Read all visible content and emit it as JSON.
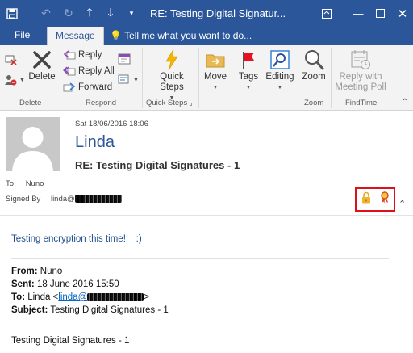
{
  "titlebar": {
    "title": "RE: Testing Digital Signatur...",
    "save_icon": "save-icon",
    "undo_icon": "undo-icon",
    "redo_icon": "redo-icon",
    "up_icon": "arrow-up-icon",
    "down_icon": "arrow-down-icon",
    "qat_icon": "customize-quick-access-icon"
  },
  "tabs": {
    "file": "File",
    "message": "Message",
    "tell_me": "Tell me what you want to do..."
  },
  "ribbon": {
    "delete": {
      "delete_label": "Delete",
      "group_label": "Delete"
    },
    "respond": {
      "reply": "Reply",
      "reply_all": "Reply All",
      "forward": "Forward",
      "group_label": "Respond"
    },
    "quick_steps": {
      "label_line1": "Quick",
      "label_line2": "Steps",
      "group_label": "Quick Steps"
    },
    "move": {
      "move": "Move",
      "tags": "Tags",
      "editing": "Editing"
    },
    "zoom": {
      "zoom": "Zoom",
      "group_label": "Zoom"
    },
    "findtime": {
      "line1": "Reply with",
      "line2": "Meeting Poll",
      "group_label": "FindTime"
    }
  },
  "message": {
    "date": "Sat 18/06/2016 18:06",
    "sender": "Linda",
    "subject": "RE: Testing Digital Signatures - 1",
    "to_label": "To",
    "to_value": "Nuno",
    "signed_by_label": "Signed By",
    "signed_by_value": "linda@"
  },
  "body": {
    "intro": "Testing encryption this time!!   :)",
    "from_label": "From:",
    "from_value": " Nuno",
    "sent_label": "Sent:",
    "sent_value": " 18 June 2016 15:50",
    "to_label": "To:",
    "to_name": " Linda <",
    "to_link": "linda@",
    "to_close": ">",
    "subject_label": "Subject:",
    "subject_value": " Testing Digital Signatures - 1",
    "quoted_body": "Testing Digital Signatures - 1"
  },
  "colors": {
    "accent": "#2b579a",
    "security_highlight": "#e0101a",
    "body_text": "#1f4e8c"
  }
}
